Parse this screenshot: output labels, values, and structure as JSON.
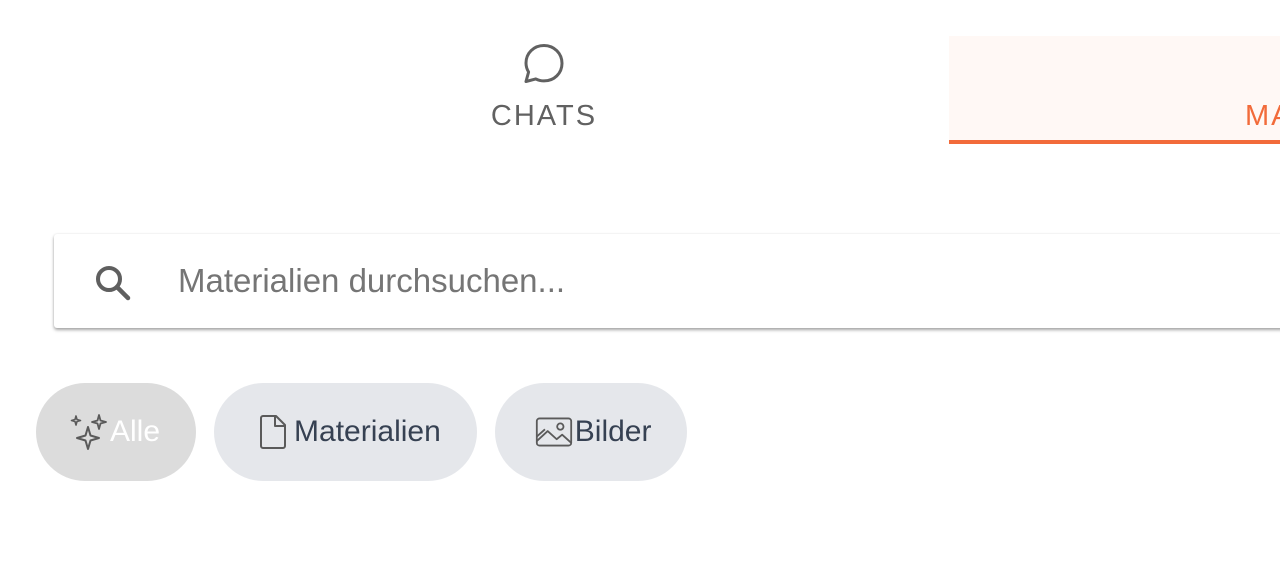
{
  "tabs": [
    {
      "label": "CHATS",
      "icon": "chat-bubble-icon",
      "active": false
    },
    {
      "label": "MA",
      "active": true
    }
  ],
  "colors": {
    "accent": "#f26b3a",
    "active_tab_bg": "#fff8f5",
    "chip_bg": "#e5e7eb",
    "chip_text": "#364152"
  },
  "search": {
    "placeholder": "Materialien durchsuchen...",
    "value": "",
    "icon": "search-icon"
  },
  "filters": [
    {
      "label": "Alle",
      "icon": "sparkles-icon",
      "selected": true
    },
    {
      "label": "Materialien",
      "icon": "document-icon",
      "selected": false
    },
    {
      "label": "Bilder",
      "icon": "image-icon",
      "selected": false
    }
  ]
}
